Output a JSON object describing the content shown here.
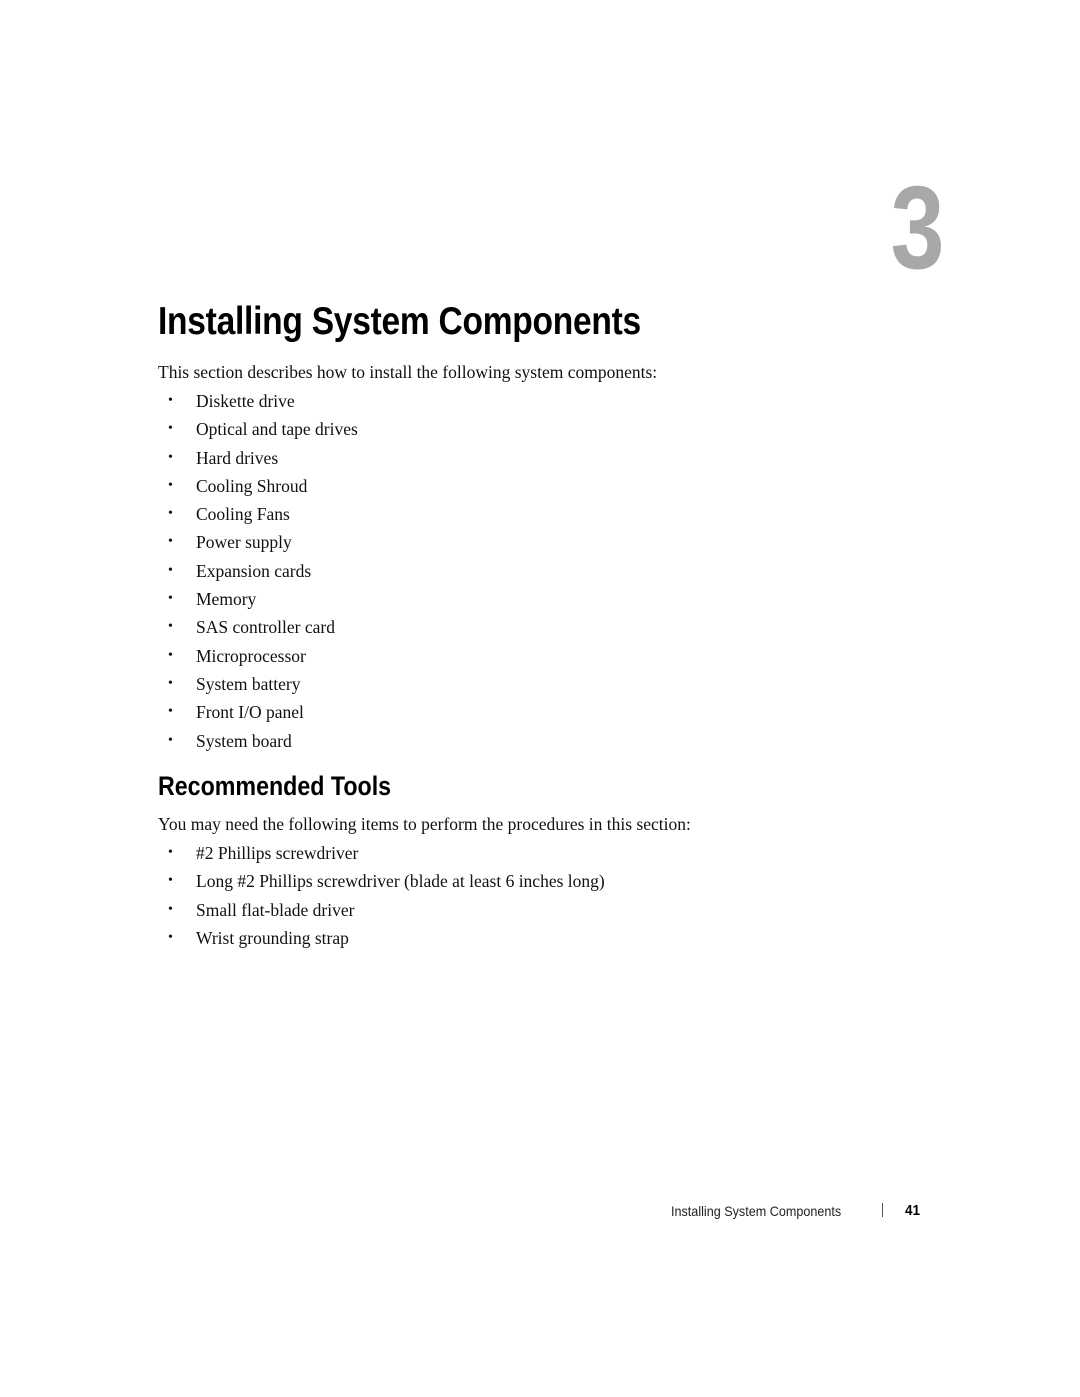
{
  "chapter": {
    "number": "3",
    "title": "Installing System Components"
  },
  "intro": {
    "text": "This section describes how to install the following system components:",
    "items": [
      "Diskette drive",
      "Optical and tape drives",
      "Hard drives",
      "Cooling Shroud",
      "Cooling Fans",
      "Power supply",
      "Expansion cards",
      "Memory",
      "SAS controller card",
      "Microprocessor",
      "System battery",
      "Front I/O panel",
      "System board"
    ]
  },
  "tools": {
    "heading": "Recommended Tools",
    "text": "You may need the following items to perform the procedures in this section:",
    "items": [
      "#2 Phillips screwdriver",
      "Long #2 Phillips screwdriver (blade at least 6 inches long)",
      "Small flat-blade driver",
      "Wrist grounding strap"
    ]
  },
  "footer": {
    "section_title": "Installing System Components",
    "page_number": "41"
  },
  "bullet_glyph": "•"
}
